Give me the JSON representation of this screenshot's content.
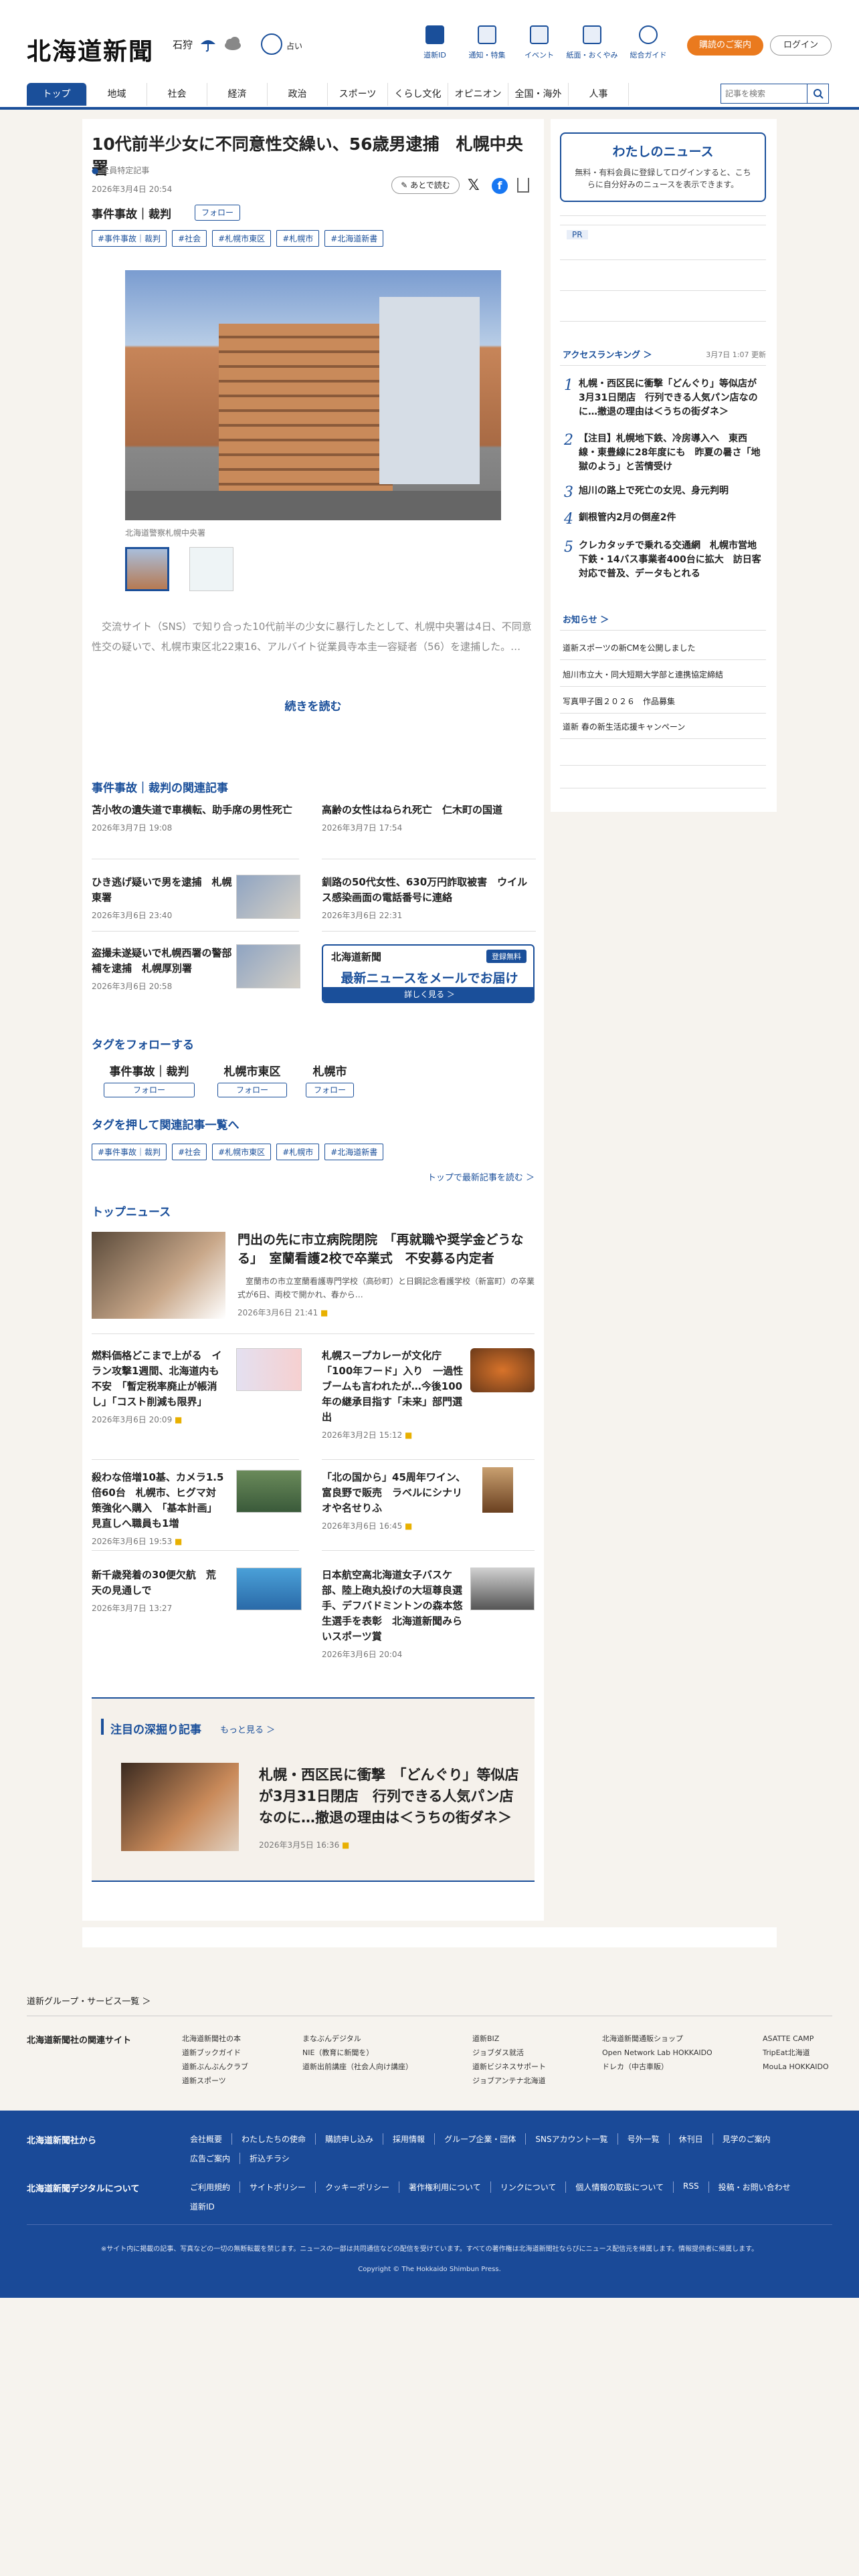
{
  "header": {
    "logo": "北海道新聞",
    "region": "石狩",
    "fortune": "占い",
    "nav": [
      "道新ID",
      "通知・特集",
      "イベント",
      "紙面・おくやみ",
      "総合ガイド"
    ],
    "subscribe": "購読のご案内",
    "login": "ログイン"
  },
  "gnav": {
    "items": [
      "トップ",
      "地域",
      "社会",
      "経済",
      "政治",
      "スポーツ",
      "くらし文化",
      "オピニオン",
      "全国・海外",
      "人事"
    ],
    "search_placeholder": "記事を検索"
  },
  "article": {
    "title": "10代前半少女に不同意性交繰い、56歳男逮捕　札幌中央署",
    "badge": "全員特定記事",
    "date": "2026年3月4日 20:54",
    "category": "事件事故｜裁判",
    "follow": "フォロー",
    "later": "あとで読む",
    "tags": [
      "#事件事故｜裁判",
      "#社会",
      "#札幌市東区",
      "#札幌市",
      "#北海道新書"
    ],
    "caption": "北海道警察札幌中央署",
    "lead": "交流サイト（SNS）で知り合った10代前半の少女に暴行したとして、札幌中央署は4日、不同意性交の疑いで、札幌市東区北22東16、アルバイト従業員寺本圭一容疑者（56）を逮捕した。…",
    "more": "続きを読む"
  },
  "related": {
    "title": "事件事故｜裁判の関連記事",
    "items": [
      {
        "t": "苫小牧の遺失道で車横転、助手席の男性死亡",
        "d": "2026年3月7日 19:08"
      },
      {
        "t": "高齢の女性はねられ死亡　仁木町の国道",
        "d": "2026年3月7日 17:54"
      },
      {
        "t": "ひき逃げ疑いで男を逮捕　札幌東署",
        "d": "2026年3月6日 23:40"
      },
      {
        "t": "釧路の50代女性、630万円詐取被害　ウイルス感染画面の電話番号に連絡",
        "d": "2026年3月6日 22:31"
      },
      {
        "t": "盗撮未遂疑いで札幌西署の警部補を逮捕　札幌厚別署",
        "d": "2026年3月6日 20:58"
      }
    ]
  },
  "banner": {
    "logo": "北海道新聞",
    "sub": "登録無料",
    "main": "最新ニュースをメールでお届け",
    "btn": "詳しく見る ＞"
  },
  "follow_tags": {
    "title": "タグをフォローする",
    "items": [
      "事件事故｜裁判",
      "札幌市東区",
      "札幌市"
    ],
    "btn": "フォロー"
  },
  "tag_list": {
    "title": "タグを押して関連記事一覧へ",
    "items": [
      "#事件事故｜裁判",
      "#社会",
      "#札幌市東区",
      "#札幌市",
      "#北海道新書"
    ],
    "more": "トップで最新記事を読む"
  },
  "top_news": {
    "title": "トップニュース",
    "lead": {
      "t": "門出の先に市立病院閉院　「再就職や奨学金どうなる」　室蘭看護2校で卒業式　不安募る内定者",
      "body": "室蘭市の市立室蘭看護専門学校（高砂町）と日鋼記念看護学校（新富町）の卒業式が6日、両校で開かれ、春から…",
      "d": "2026年3月6日 21:41"
    },
    "items": [
      {
        "t": "燃料価格どこまで上がる　イラン攻撃1週間、北海道内も不安　「暫定税率廃止が帳消し」「コスト削減も限界」",
        "d": "2026年3月6日 20:09"
      },
      {
        "t": "札幌スープカレーが文化庁「100年フード」入り　一過性ブームも言われたが…今後100年の継承目指す「未来」部門選出",
        "d": "2026年3月2日 15:12"
      },
      {
        "t": "殺わな倍増10基、カメラ1.5倍60台　札幌市、ヒグマ対策強化へ購入　「基本計画」見直しへ職員も1増",
        "d": "2026年3月6日 19:53"
      },
      {
        "t": "「北の国から」45周年ワイン、富良野で販売　ラベルにシナリオや名せりふ",
        "d": "2026年3月6日 16:45"
      },
      {
        "t": "新千歳発着の30便欠航　荒天の見通しで",
        "d": "2026年3月7日 13:27"
      },
      {
        "t": "日本航空高北海道女子バスケ部、陸上砲丸投げの大垣尊良選手、デフバドミントンの森本悠生選手を表彰　北海道新聞みらいスポーツ賞",
        "d": "2026年3月6日 20:04"
      }
    ]
  },
  "deep": {
    "title": "注目の深掘り記事",
    "more": "もっと見る",
    "t": "札幌・西区民に衝撃　「どんぐり」等似店が3月31日閉店　行列できる人気パン店なのに…撤退の理由は＜うちの街ダネ＞",
    "d": "2026年3月5日 16:36"
  },
  "side": {
    "mynews_title": "わたしのニュース",
    "mynews_body": "無料・有料会員に登録してログインすると、こちらに自分好みのニュースを表示できます。",
    "pr": "PR",
    "rank_title": "アクセスランキング",
    "rank_date": "3月7日 1:07 更新",
    "ranking": [
      "札幌・西区民に衝撃「どんぐり」等似店が3月31日閉店　行列できる人気パン店なのに…撤退の理由は＜うちの街ダネ＞",
      "【注目】札幌地下鉄、冷房導入へ　東西線・東豊線に28年度にも　昨夏の暑さ「地獄のよう」と苦情受け",
      "旭川の路上で死亡の女児、身元判明",
      "釧根管内2月の倒産2件",
      "クレカタッチで乗れる交通網　札幌市営地下鉄・14バス事業者400台に拡大　訪日客対応で普及、データもとれる"
    ],
    "notice_title": "お知らせ",
    "notices": [
      "道新スポーツの新CMを公開しました",
      "旭川市立大・同大短期大学部と連携協定締結",
      "写真甲子園２０２６　作品募集",
      "道新 春の新生活応援キャンペーン"
    ]
  },
  "group": {
    "title": "道新グループ・サービス一覧",
    "sites_label": "北海道新聞社の関連サイト",
    "cols": [
      [
        "北海道新聞社の本",
        "道新ブックガイド",
        "道新ぶんぶんクラブ",
        "道新スポーツ"
      ],
      [
        "まなぶんデジタル",
        "NIE（教育に新聞を）",
        "道新出前講座（社会人向け講座）"
      ],
      [
        "道新BIZ",
        "ジョブダス就活",
        "道新ビジネスサポート",
        "ジョブアンテナ北海道"
      ],
      [
        "北海道新聞通販ショップ",
        "Open Network Lab HOKKAIDO",
        "ドレカ（中古車販）"
      ],
      [
        "ASATTE CAMP",
        "TripEat北海道",
        "MouLa HOKKAIDO"
      ]
    ]
  },
  "footer": {
    "row1_label": "北海道新聞社から",
    "row1": [
      "会社概要",
      "わたしたちの使命",
      "購読申し込み",
      "採用情報",
      "グループ企業・団体",
      "SNSアカウント一覧",
      "号外一覧",
      "休刊日",
      "見学のご案内",
      "広告ご案内",
      "折込チラシ"
    ],
    "row2_label": "北海道新聞デジタルについて",
    "row2": [
      "ご利用規約",
      "サイトポリシー",
      "クッキーポリシー",
      "著作権利用について",
      "リンクについて",
      "個人情報の取扱について",
      "RSS",
      "投稿・お問い合わせ",
      "道新ID"
    ],
    "notice": "※サイト内に掲載の記事、写真などの一切の無断転載を禁じます。ニュースの一部は共同通信などの配信を受けています。すべての著作権は北海道新聞社ならびにニュース配信元を帰属します。情報提供者に帰属します。",
    "copyright": "Copyright © The Hokkaido Shimbun Press."
  }
}
